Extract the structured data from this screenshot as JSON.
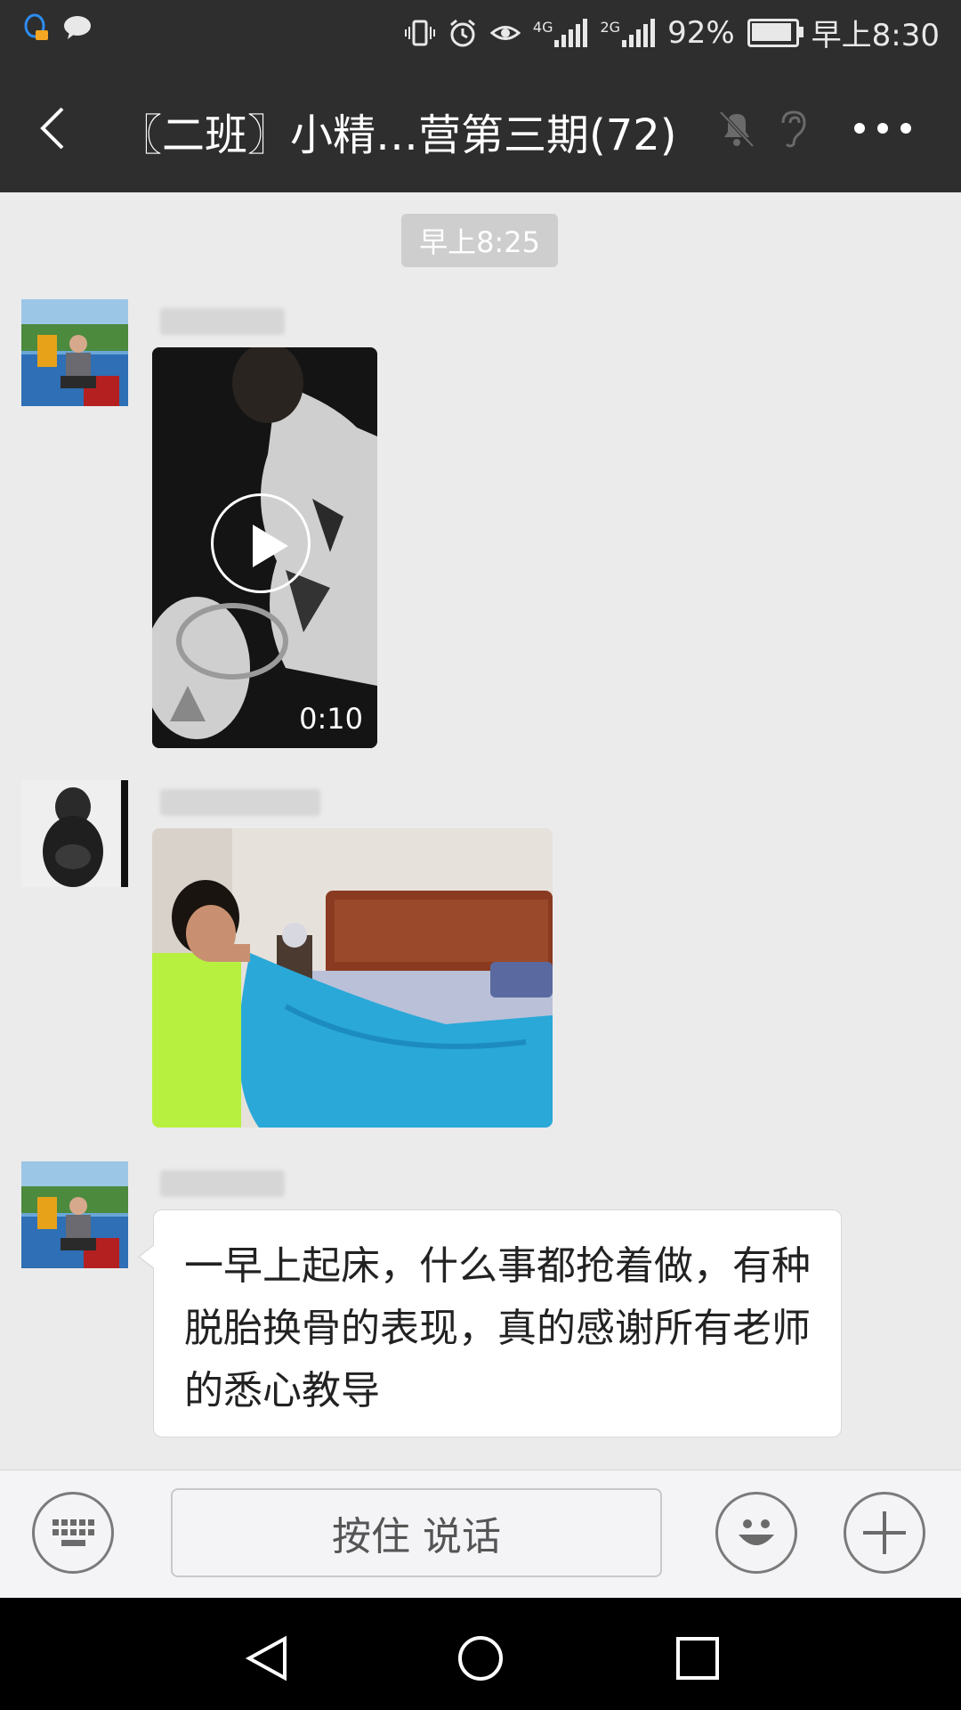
{
  "status_bar": {
    "network": "4G",
    "network2": "2G",
    "battery_text": "92%",
    "battery_level": 0.92,
    "time": "早上8:30"
  },
  "header": {
    "title": "〖二班〗小精…营第三期(72)"
  },
  "chat": {
    "timestamp": "早上8:25",
    "video": {
      "duration": "0:10"
    },
    "text_message": "一早上起床，什么事都抢着做，有种脱胎换骨的表现，真的感谢所有老师的悉心教导"
  },
  "input_bar": {
    "hold_to_talk": "按住 说话"
  },
  "colors": {
    "header_bg": "#2e2e2e",
    "chat_bg": "#ebebeb",
    "bubble_bg": "#ffffff"
  },
  "icons": {
    "back": "back-arrow-icon",
    "mute": "bell-muted-icon",
    "ear": "earpiece-icon",
    "more": "more-icon",
    "keyboard": "keyboard-icon",
    "emoji": "emoji-icon",
    "plus": "plus-icon"
  }
}
